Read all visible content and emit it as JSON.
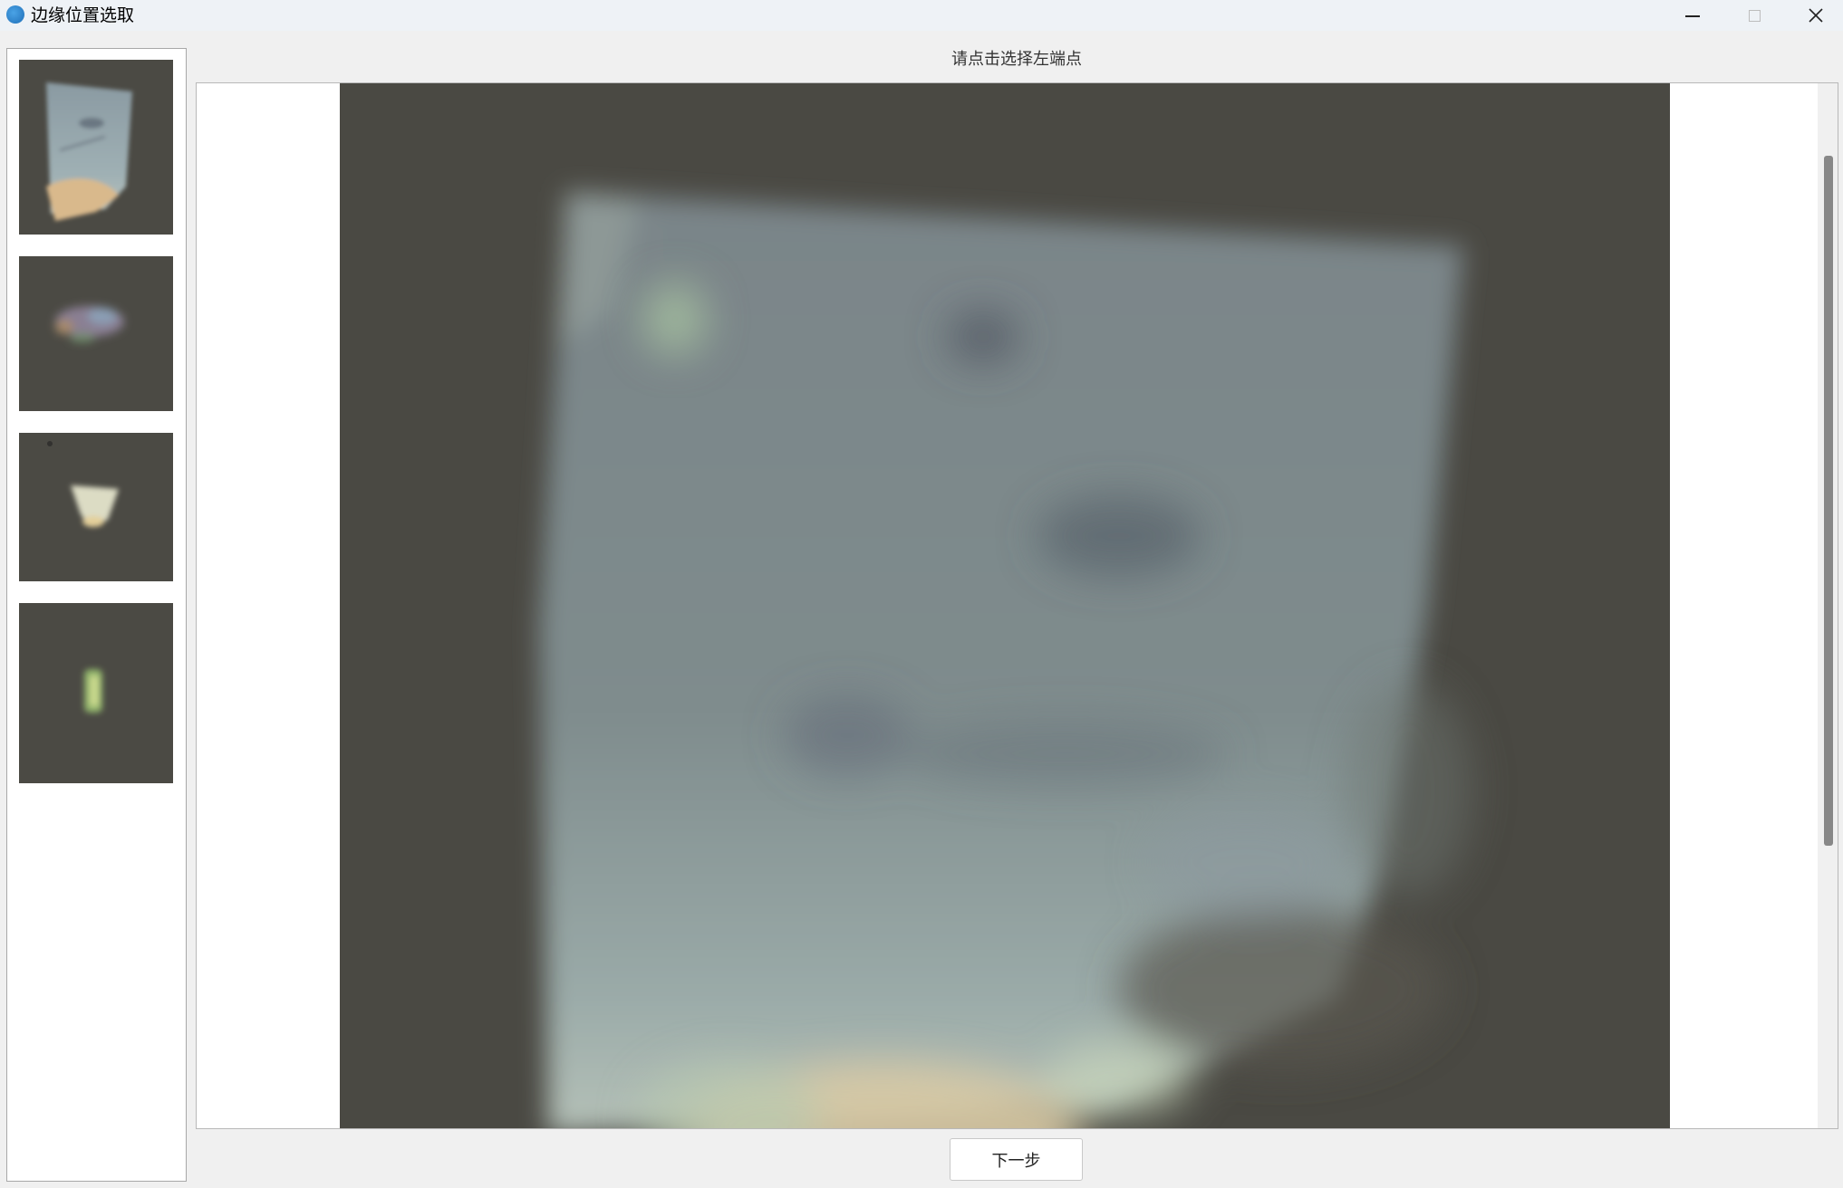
{
  "window": {
    "title": "边缘位置选取",
    "icon": "app-icon",
    "controls": [
      "minimize-icon",
      "maximize-icon",
      "close-icon"
    ]
  },
  "thumbnails": {
    "items": [
      {
        "name": "thumbnail-1"
      },
      {
        "name": "thumbnail-2"
      },
      {
        "name": "thumbnail-3"
      },
      {
        "name": "thumbnail-4"
      }
    ]
  },
  "main": {
    "instruction": "请点击选择左端点"
  },
  "footer": {
    "next_label": "下一步"
  },
  "colors": {
    "titlebar_bg": "#eef2f6",
    "window_bg": "#f0f0f0",
    "image_dark_bg": "#4a4943",
    "scroll_thumb": "#888888"
  }
}
